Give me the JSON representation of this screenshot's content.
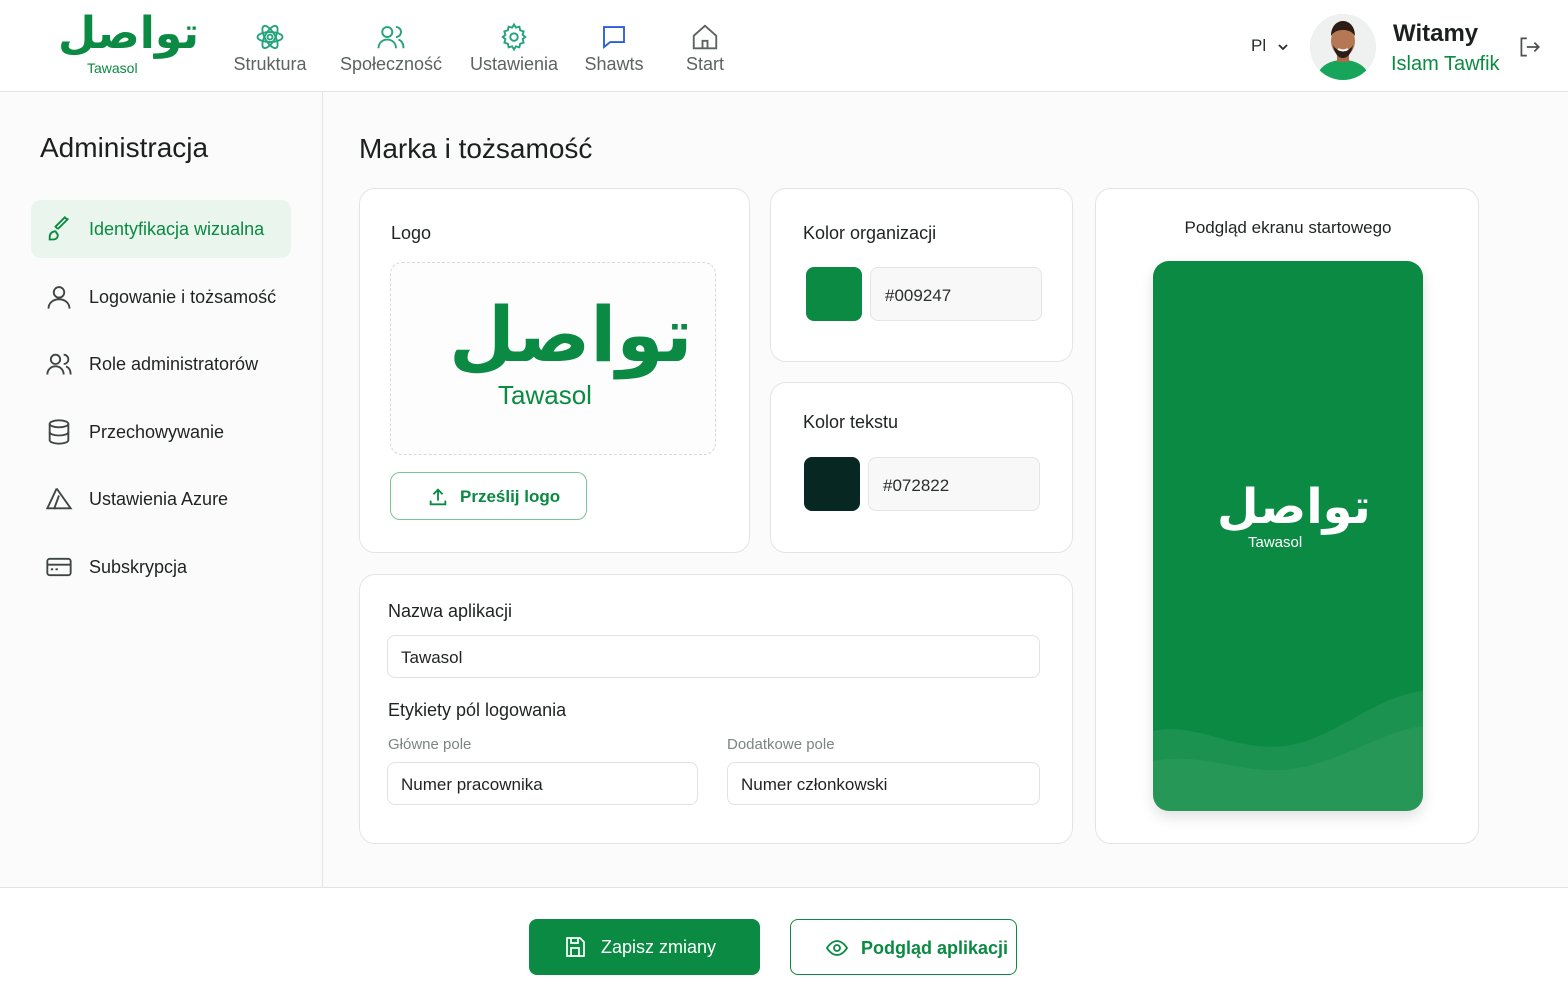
{
  "header": {
    "brand_arabic": "تواصل",
    "brand_latin": "Tawasol",
    "nav": [
      {
        "label": "Struktura",
        "icon": "atom-icon"
      },
      {
        "label": "Społeczność",
        "icon": "users-icon"
      },
      {
        "label": "Ustawienia",
        "icon": "gear-icon"
      },
      {
        "label": "Shawts",
        "icon": "chat-bubble-icon"
      },
      {
        "label": "Start",
        "icon": "home-icon"
      }
    ],
    "language": "Pl",
    "welcome": "Witamy",
    "user_name": "Islam Tawfik"
  },
  "sidebar": {
    "title": "Administracja",
    "items": [
      {
        "label": "Identyfikacja wizualna",
        "icon": "brush-icon",
        "active": true
      },
      {
        "label": "Logowanie i tożsamość",
        "icon": "user-icon"
      },
      {
        "label": "Role administratorów",
        "icon": "users-icon"
      },
      {
        "label": "Przechowywanie",
        "icon": "database-icon"
      },
      {
        "label": "Ustawienia Azure",
        "icon": "azure-icon"
      },
      {
        "label": "Subskrypcja",
        "icon": "card-icon"
      }
    ]
  },
  "main": {
    "title": "Marka i tożsamość",
    "logo_card": {
      "label": "Logo",
      "logo_arabic": "تواصل",
      "logo_latin": "Tawasol",
      "upload_label": "Prześlij logo"
    },
    "org_color": {
      "label": "Kolor organizacji",
      "value": "#009247",
      "swatch": "#0a8a42"
    },
    "text_color": {
      "label": "Kolor tekstu",
      "value": "#072822",
      "swatch": "#072822"
    },
    "app_settings": {
      "app_name_label": "Nazwa aplikacji",
      "app_name_value": "Tawasol",
      "login_fields_label": "Etykiety pól logowania",
      "primary_field_label": "Główne pole",
      "primary_field_value": "Numer pracownika",
      "secondary_field_label": "Dodatkowe pole",
      "secondary_field_value": "Numer członkowski"
    },
    "preview": {
      "title": "Podgląd ekranu startowego",
      "logo_arabic": "تواصل",
      "logo_latin": "Tawasol"
    }
  },
  "footer": {
    "save_label": "Zapisz zmiany",
    "preview_label": "Podgląd aplikacji"
  },
  "colors": {
    "accent": "#0a8a42",
    "text_dark": "#072822"
  }
}
